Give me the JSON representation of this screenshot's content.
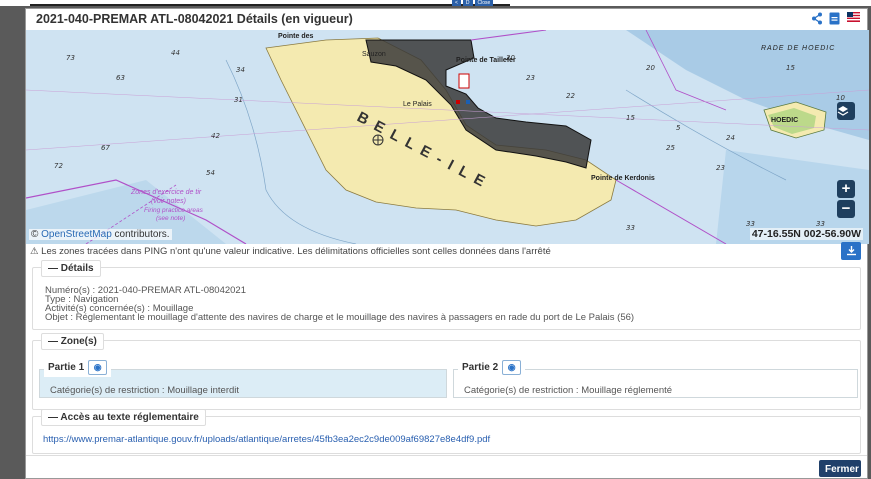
{
  "top_buttons": [
    "<",
    "D",
    "Close"
  ],
  "modal": {
    "title": "2021-040-PREMAR ATL-08042021 Détails (en vigueur)",
    "header_icons": [
      "share-icon",
      "pdf-icon",
      "flag-icon"
    ]
  },
  "map": {
    "attribution_link": "OpenStreetMap",
    "attribution_rest": " contributors.",
    "attribution_prefix": "© ",
    "coords": "47-16.55N 002-56.90W",
    "labels": {
      "island": "B E L L E - I L E",
      "sauzon": "Sauzon",
      "le_palais": "Le Palais",
      "pointe_des": "Pointe des",
      "pointe_kerdonis": "Pointe de Kerdonis",
      "pointe_taillefer": "Pointe de Taillefer",
      "rade_hoedic": "RADE DE HOEDIC",
      "hoedic": "HOEDIC",
      "zones_exercice": "Zones d'exercice de tir",
      "voir_notes": "(voir notes)",
      "firing_practice": "Firing practice areas",
      "see_note": "(see note)"
    },
    "zoom_in": "+",
    "zoom_out": "−",
    "layers_icon": "layers-icon"
  },
  "warning": "⚠ Les zones tracées dans PING n'ont qu'une valeur indicative. Les délimitations officielles sont celles données dans l'arrêté",
  "details": {
    "legend": "— Détails",
    "numero": "Numéro(s) : 2021-040-PREMAR ATL-08042021",
    "type": "Type : Navigation",
    "activite": "Activité(s) concernée(s) : Mouillage",
    "objet": "Objet : Réglementant le mouillage d'attente des navires de charge et le mouillage des navires à passagers en rade du port de Le Palais (56)"
  },
  "zones": {
    "legend": "— Zone(s)",
    "parts": [
      {
        "label": "Partie 1",
        "category": "Catégorie(s) de restriction : Mouillage interdit"
      },
      {
        "label": "Partie 2",
        "category": "Catégorie(s) de restriction : Mouillage réglementé"
      }
    ]
  },
  "acces": {
    "legend": "— Accès au texte réglementaire",
    "url": "https://www.premar-atlantique.gouv.fr/uploads/atlantique/arretes/45fb3ea2ec2c9de009af69827e8e4df9.pdf"
  },
  "footer": {
    "close_label": "Fermer"
  },
  "colors": {
    "accent": "#2a72c7",
    "close_bg": "#20406a",
    "zone_fill": "#3a3a3a",
    "land": "#f4eab0",
    "sea": "#c9dff0"
  }
}
